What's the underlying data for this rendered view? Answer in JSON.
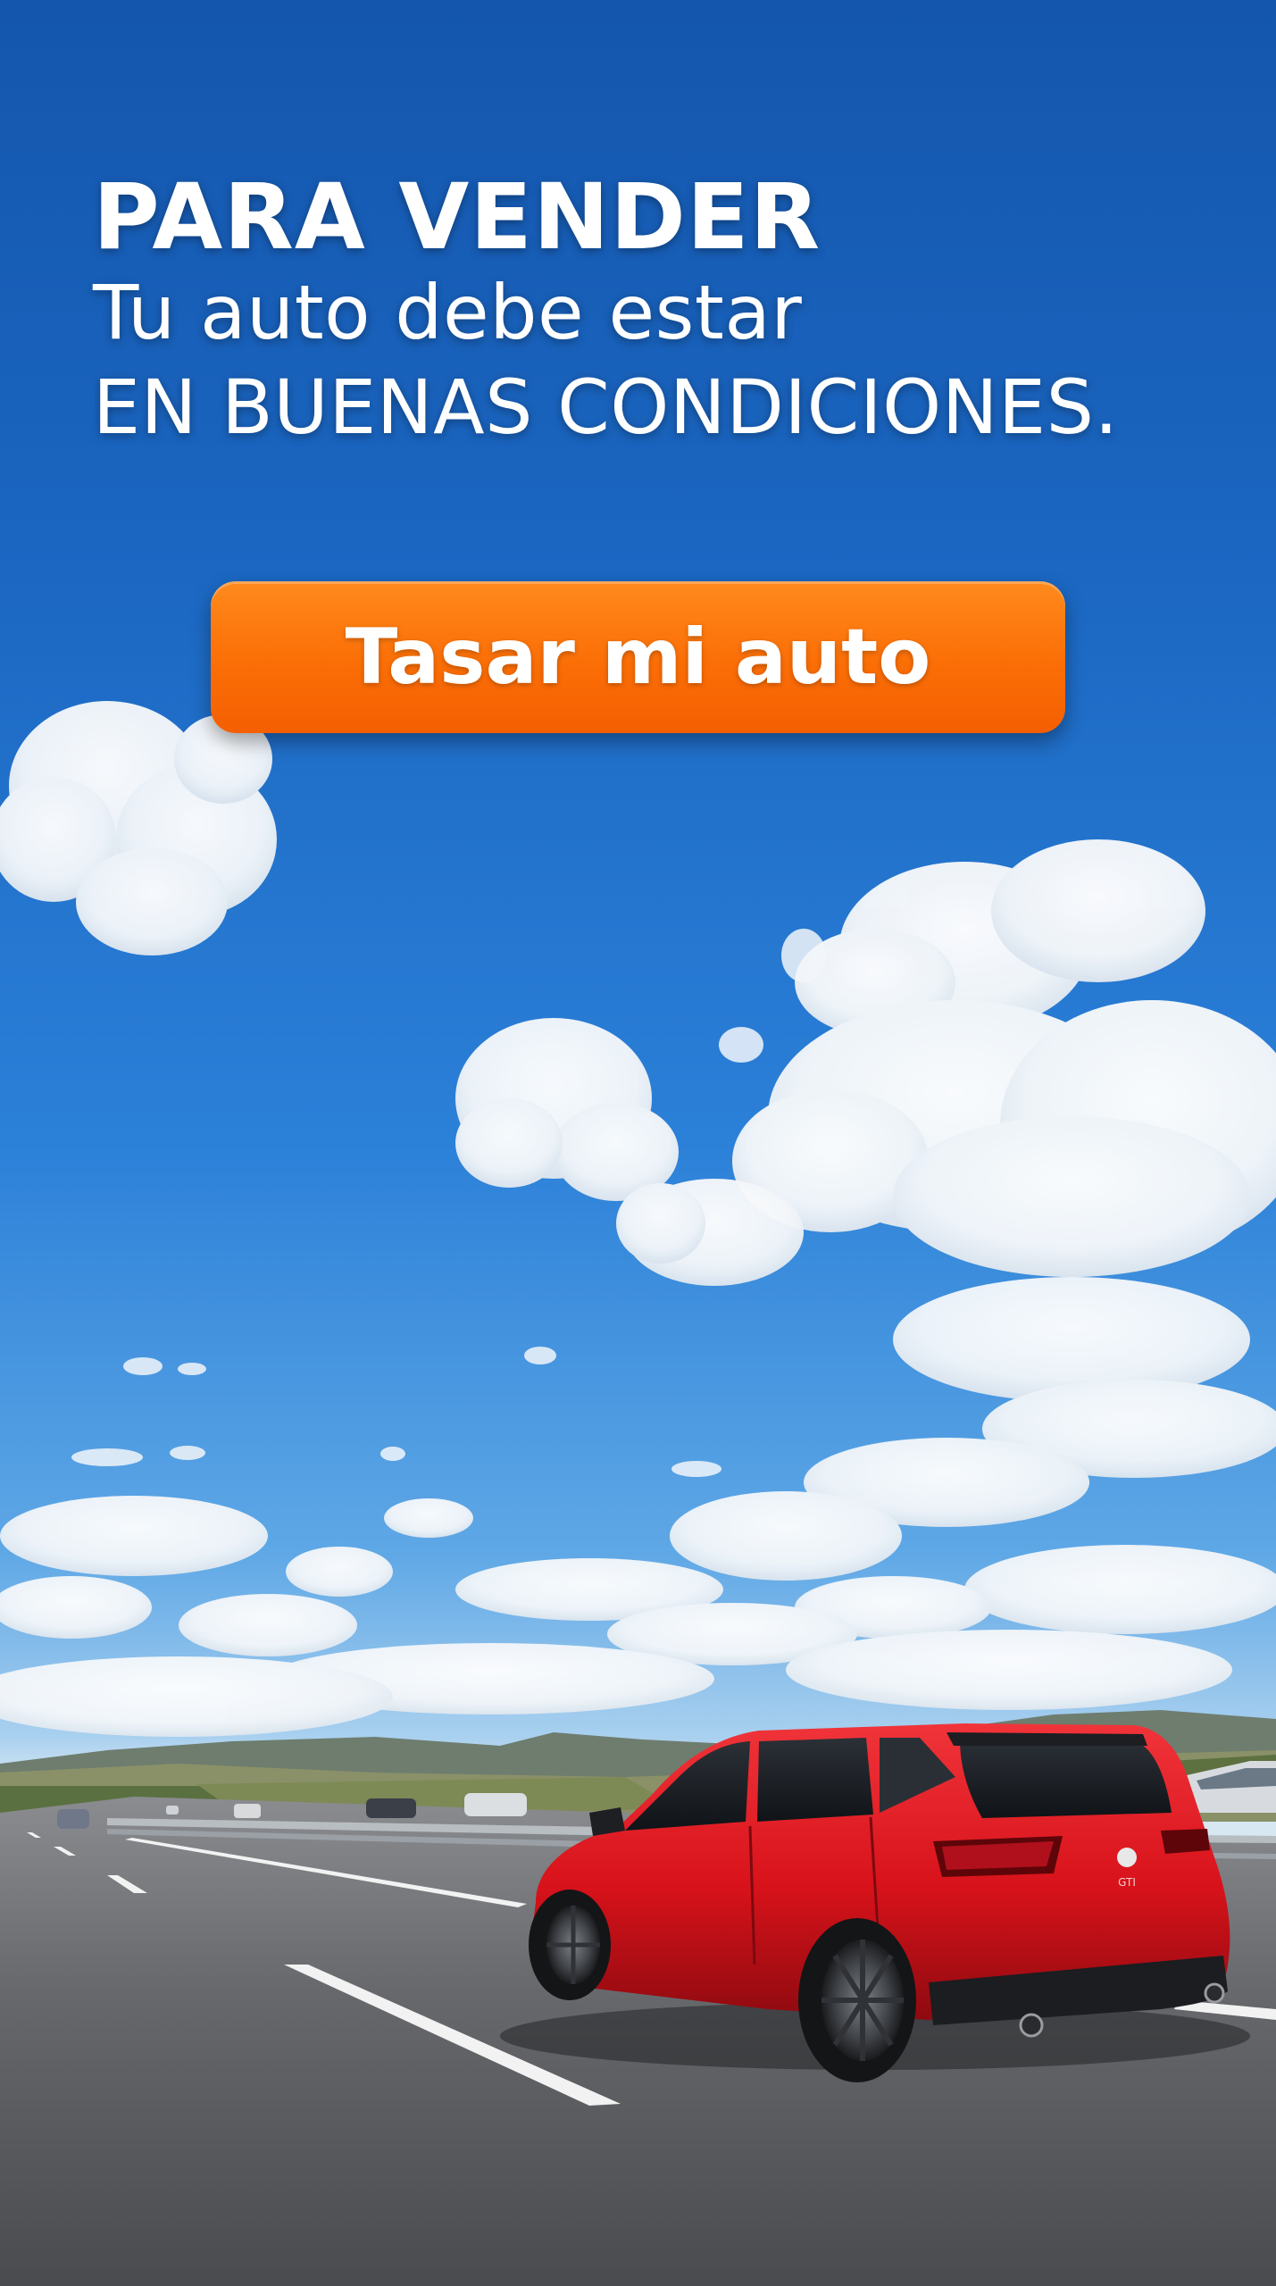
{
  "headline": {
    "line1": "PARA VENDER",
    "line2": "Tu auto debe estar",
    "line3": "EN BUENAS CONDICIONES."
  },
  "cta": {
    "label": "Tasar mi auto",
    "color": "#fb6e06"
  },
  "car": {
    "color": "#d8121a",
    "badge": "GTI"
  },
  "colors": {
    "sky_top": "#1456ad",
    "sky_mid": "#2b80d8",
    "road": "#5f6065",
    "text": "#ffffff"
  }
}
